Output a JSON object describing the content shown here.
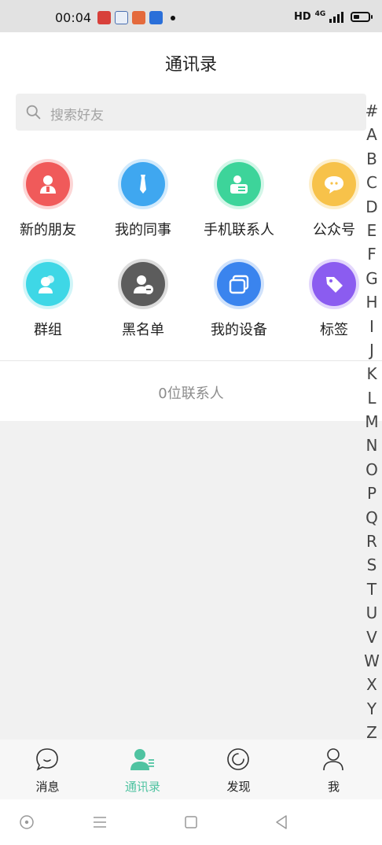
{
  "status_bar": {
    "time": "00:04",
    "network": "HD",
    "net_type": "4G"
  },
  "header": {
    "title": "通讯录"
  },
  "search": {
    "placeholder": "搜索好友"
  },
  "grid": [
    {
      "label": "新的朋友",
      "icon": "new-friend-icon",
      "color": "#f05a5a"
    },
    {
      "label": "我的同事",
      "icon": "tie-icon",
      "color": "#3fa7f0"
    },
    {
      "label": "手机联系人",
      "icon": "phone-contact-icon",
      "color": "#3dd49a"
    },
    {
      "label": "公众号",
      "icon": "chat-bubble-icon",
      "color": "#f7c24a"
    },
    {
      "label": "群组",
      "icon": "group-icon",
      "color": "#3ed7e6"
    },
    {
      "label": "黑名单",
      "icon": "blocked-user-icon",
      "color": "#5c5c5c"
    },
    {
      "label": "我的设备",
      "icon": "device-window-icon",
      "color": "#3a84ee"
    },
    {
      "label": "标签",
      "icon": "tag-icon",
      "color": "#8b5cf0"
    }
  ],
  "contact_count": "0位联系人",
  "alpha_index": [
    "#",
    "A",
    "B",
    "C",
    "D",
    "E",
    "F",
    "G",
    "H",
    "I",
    "J",
    "K",
    "L",
    "M",
    "N",
    "O",
    "P",
    "Q",
    "R",
    "S",
    "T",
    "U",
    "V",
    "W",
    "X",
    "Y",
    "Z"
  ],
  "tabs": [
    {
      "label": "消息",
      "icon": "message-bubble-icon",
      "active": false
    },
    {
      "label": "通讯录",
      "icon": "contacts-icon",
      "active": true
    },
    {
      "label": "发现",
      "icon": "discover-icon",
      "active": false
    },
    {
      "label": "我",
      "icon": "profile-icon",
      "active": false
    }
  ],
  "colors": {
    "accent": "#4fc3a1",
    "background": "#f1f1f1"
  }
}
